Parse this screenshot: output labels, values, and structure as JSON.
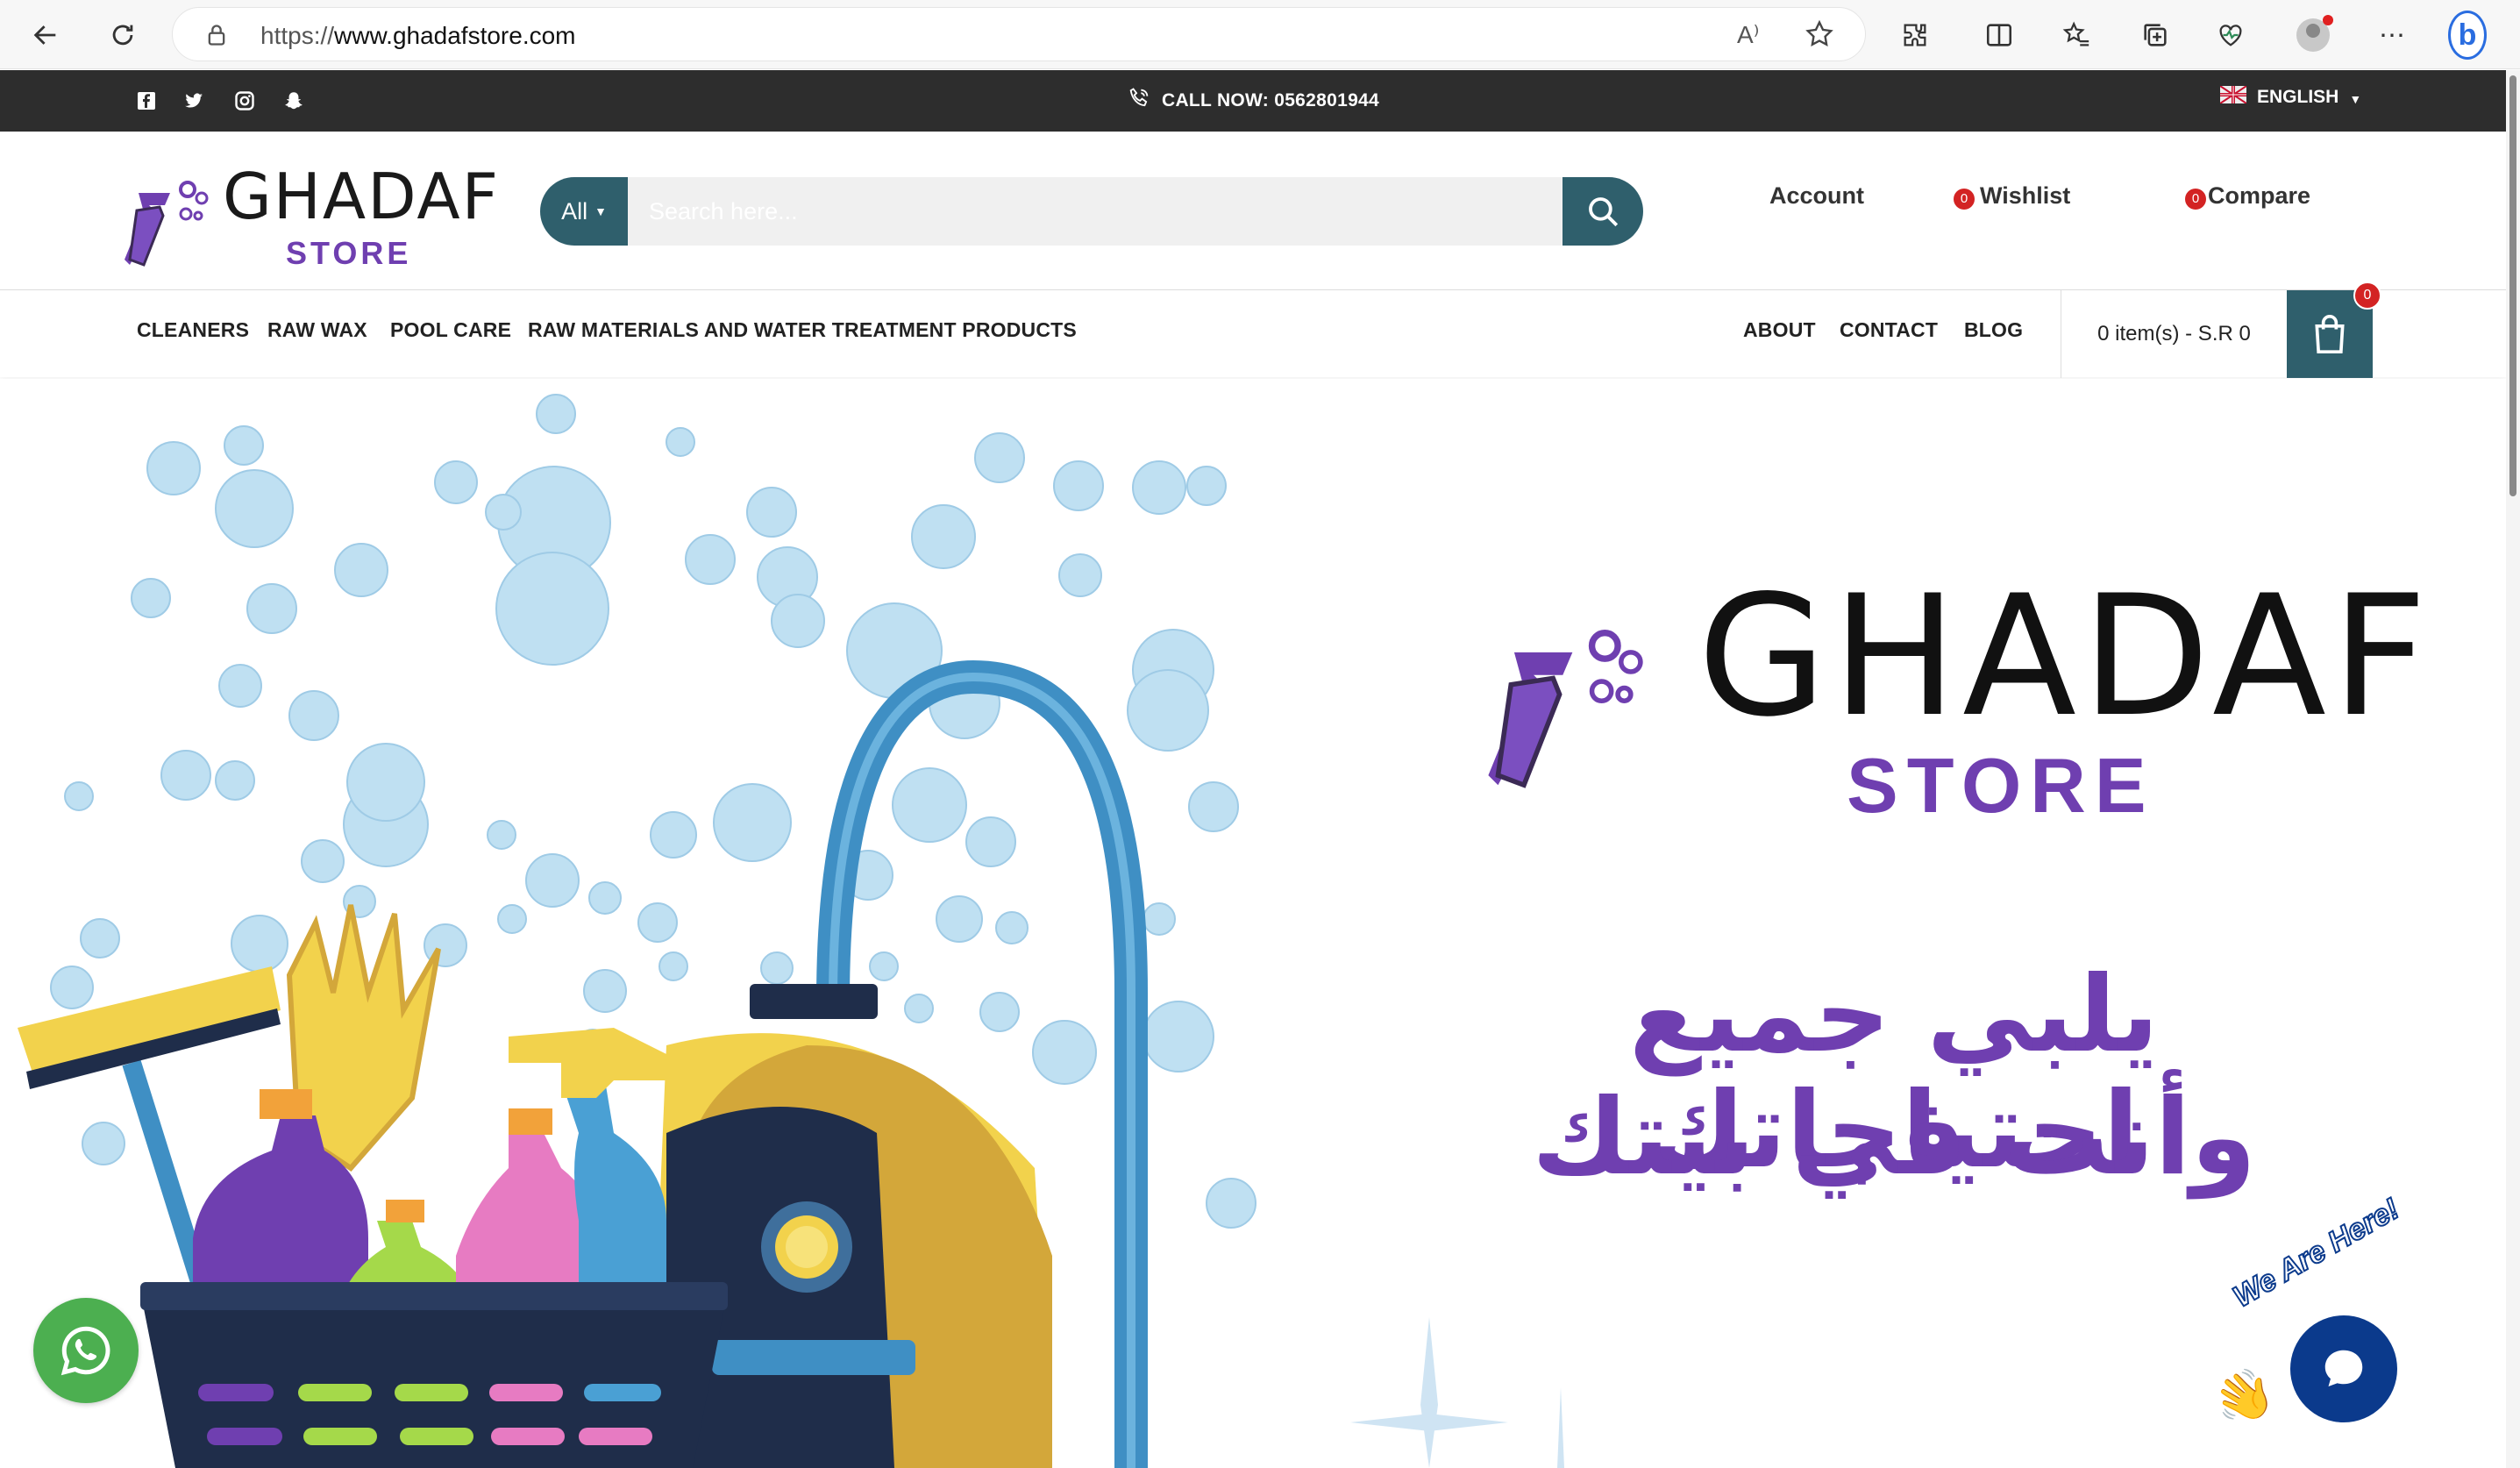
{
  "browser": {
    "url_prefix": "https://",
    "url_domain": "www.ghadafstore.com"
  },
  "topbar": {
    "call_now": "CALL NOW: 0562801944",
    "language": "ENGLISH",
    "socials": [
      "facebook-icon",
      "twitter-icon",
      "instagram-icon",
      "snapchat-icon"
    ]
  },
  "logo": {
    "name": "GHADAF",
    "sub": "STORE"
  },
  "search": {
    "category": "All",
    "placeholder": "Search here..."
  },
  "header_links": {
    "account": "Account",
    "wishlist": "Wishlist",
    "wishlist_count": "0",
    "compare": "Compare",
    "compare_count": "0"
  },
  "nav": {
    "left": [
      "CLEANERS",
      "RAW WAX",
      "POOL CARE",
      "RAW MATERIALS AND WATER TREATMENT PRODUCTS"
    ],
    "right": [
      "ABOUT",
      "CONTACT",
      "BLOG"
    ],
    "cart_summary": "0 item(s) - S.R 0",
    "cart_count": "0"
  },
  "hero": {
    "logo_name": "GHADAF",
    "logo_sub": "STORE",
    "arabic_line1": "يلبي جميع احتياجاتك",
    "arabic_line2": "وأنت في بيتك"
  },
  "chat": {
    "badge": "We Are Here!"
  },
  "colors": {
    "primary": "#2f5f6c",
    "purple": "#6f3fb0",
    "badge": "#d32323",
    "topbar": "#2d2d2d",
    "whatsapp": "#4caf50"
  }
}
